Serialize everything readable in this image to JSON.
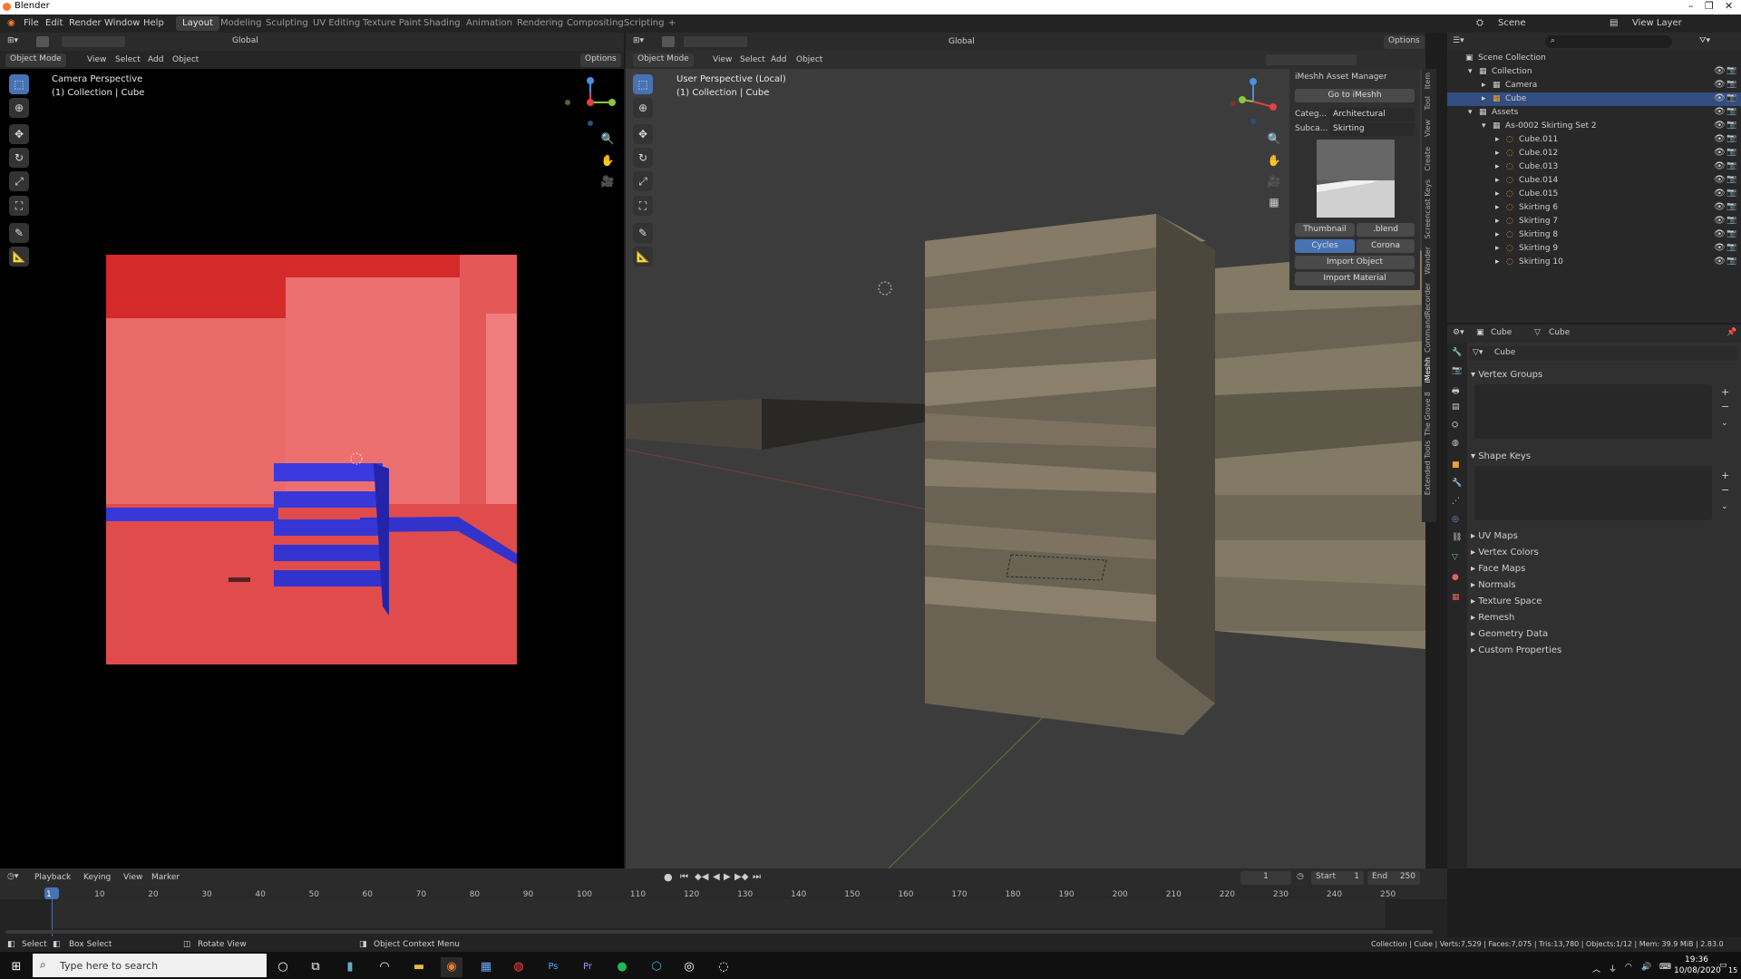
{
  "window": {
    "title": "Blender",
    "controls": [
      "–",
      "❐",
      "✕"
    ]
  },
  "menu": [
    "File",
    "Edit",
    "Render",
    "Window",
    "Help"
  ],
  "workspaces": [
    "Layout",
    "Modeling",
    "Sculpting",
    "UV Editing",
    "Texture Paint",
    "Shading",
    "Animation",
    "Rendering",
    "Compositing",
    "Scripting",
    "+"
  ],
  "top_right": {
    "scene": "Scene",
    "view_layer": "View Layer"
  },
  "left_view": {
    "mode": "Object Mode",
    "menus": [
      "View",
      "Select",
      "Add",
      "Object"
    ],
    "transform": "Global",
    "options": "Options",
    "title": "Camera Perspective",
    "subtitle": "(1) Collection | Cube"
  },
  "right_view": {
    "mode": "Object Mode",
    "menus": [
      "View",
      "Select",
      "Add",
      "Object"
    ],
    "transform": "Global",
    "options": "Options",
    "title": "User Perspective (Local)",
    "subtitle": "(1) Collection | Cube"
  },
  "asset_manager": {
    "header": "iMeshh Asset Manager",
    "goto": "Go to iMeshh",
    "category_label": "Categ...",
    "category_value": "Architectural",
    "subcategory_label": "Subca...",
    "subcategory_value": "Skirting",
    "thumbnail_btn": "Thumbnail",
    "blend_btn": ".blend",
    "engine_cycles": "Cycles",
    "engine_corona": "Corona",
    "import_object": "Import Object",
    "import_material": "Import Material"
  },
  "side_tabs": [
    "Item",
    "Tool",
    "View",
    "Create",
    "Screencast Keys",
    "Wander",
    "CommandRecorder",
    "iMeshh",
    "The Grove 8",
    "Extended Tools"
  ],
  "outliner": {
    "search_placeholder": "",
    "rows": [
      {
        "label": "Scene Collection",
        "indent": 0,
        "arrow": ""
      },
      {
        "label": "Collection",
        "indent": 1,
        "arrow": "▾"
      },
      {
        "label": "Camera",
        "indent": 2,
        "arrow": "▸"
      },
      {
        "label": "Cube",
        "indent": 2,
        "arrow": "▸",
        "selected": true
      },
      {
        "label": "Assets",
        "indent": 1,
        "arrow": "▾"
      },
      {
        "label": "As-0002 Skirting Set 2",
        "indent": 2,
        "arrow": "▾"
      },
      {
        "label": "Cube.011",
        "indent": 3,
        "arrow": "▸"
      },
      {
        "label": "Cube.012",
        "indent": 3,
        "arrow": "▸"
      },
      {
        "label": "Cube.013",
        "indent": 3,
        "arrow": "▸"
      },
      {
        "label": "Cube.014",
        "indent": 3,
        "arrow": "▸"
      },
      {
        "label": "Cube.015",
        "indent": 3,
        "arrow": "▸"
      },
      {
        "label": "Skirting 6",
        "indent": 3,
        "arrow": "▸"
      },
      {
        "label": "Skirting 7",
        "indent": 3,
        "arrow": "▸"
      },
      {
        "label": "Skirting 8",
        "indent": 3,
        "arrow": "▸"
      },
      {
        "label": "Skirting 9",
        "indent": 3,
        "arrow": "▸"
      },
      {
        "label": "Skirting 10",
        "indent": 3,
        "arrow": "▸"
      }
    ]
  },
  "properties": {
    "breadcrumb_object": "Cube",
    "breadcrumb_mesh": "Cube",
    "name_field": "Cube",
    "sections": [
      "Vertex Groups",
      "Shape Keys"
    ],
    "collapsed": [
      "UV Maps",
      "Vertex Colors",
      "Face Maps",
      "Normals",
      "Texture Space",
      "Remesh",
      "Geometry Data",
      "Custom Properties"
    ]
  },
  "timeline": {
    "menus": [
      "Playback",
      "Keying",
      "View",
      "Marker"
    ],
    "current_frame": "1",
    "start_label": "Start",
    "start": "1",
    "end_label": "End",
    "end": "250",
    "ticks": [
      "1",
      "10",
      "20",
      "30",
      "40",
      "50",
      "60",
      "70",
      "80",
      "90",
      "100",
      "110",
      "120",
      "130",
      "140",
      "150",
      "160",
      "170",
      "180",
      "190",
      "200",
      "210",
      "220",
      "230",
      "240",
      "250"
    ]
  },
  "statusbar": {
    "select": "Select",
    "box_select": "Box Select",
    "rotate_view": "Rotate View",
    "context_menu": "Object Context Menu",
    "stats": "Collection | Cube | Verts:7,529 | Faces:7,075 | Tris:13,780 | Objects:1/12 | Mem: 39.9 MiB | 2.83.0"
  },
  "taskbar": {
    "search_placeholder": "Type here to search",
    "time": "19:36",
    "date": "10/08/2020",
    "badge": "15"
  },
  "colors": {
    "accent": "#4772b3",
    "wall": "#e86060",
    "skirting": "#3838d8",
    "model": "#8a8070"
  }
}
